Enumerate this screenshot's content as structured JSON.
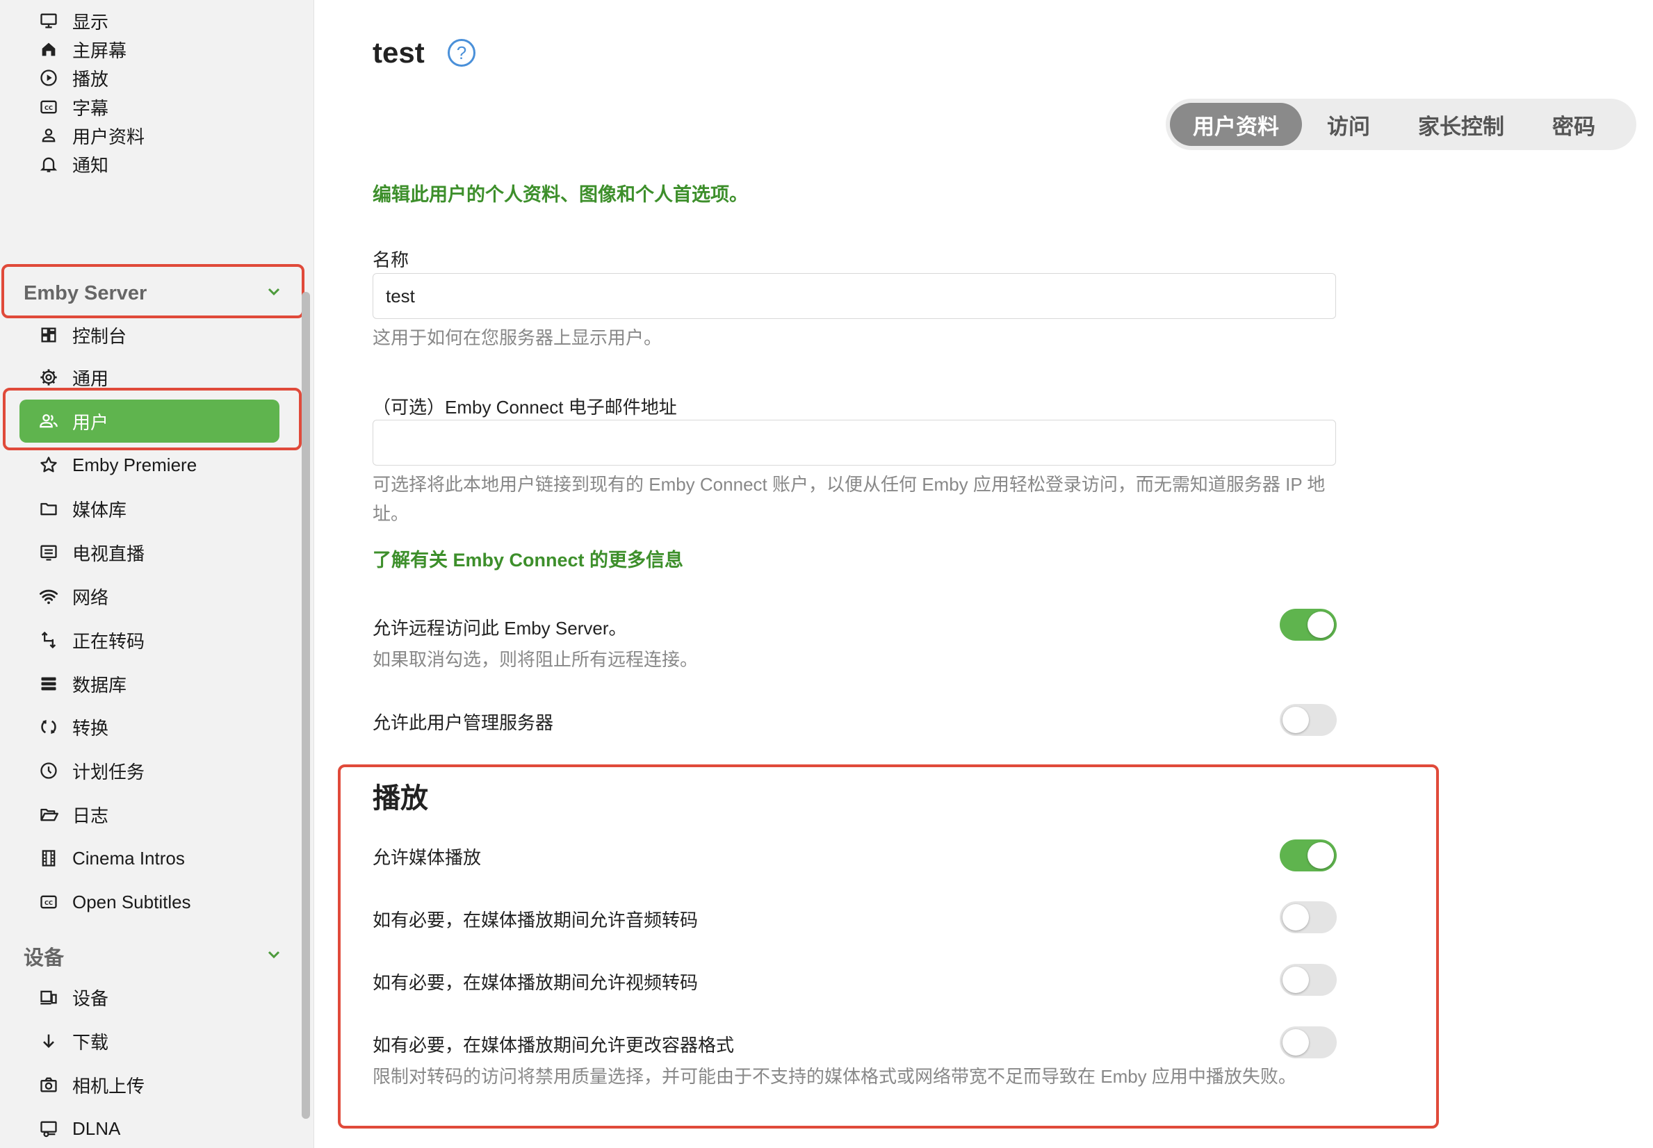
{
  "sidebar": {
    "items_top": [
      {
        "icon": "monitor-icon",
        "label": "显示"
      },
      {
        "icon": "home-icon",
        "label": "主屏幕"
      },
      {
        "icon": "play-circle-icon",
        "label": "播放"
      },
      {
        "icon": "cc-icon",
        "label": "字幕"
      },
      {
        "icon": "person-icon",
        "label": "用户资料"
      },
      {
        "icon": "bell-icon",
        "label": "通知"
      }
    ],
    "server_section": "Emby Server",
    "server_items": [
      {
        "icon": "dashboard-icon",
        "label": "控制台"
      },
      {
        "icon": "gear-icon",
        "label": "通用"
      },
      {
        "icon": "users-icon",
        "label": "用户"
      },
      {
        "icon": "star-icon",
        "label": "Emby Premiere"
      },
      {
        "icon": "folder-icon",
        "label": "媒体库"
      },
      {
        "icon": "tv-guide-icon",
        "label": "电视直播"
      },
      {
        "icon": "wifi-icon",
        "label": "网络"
      },
      {
        "icon": "transcode-icon",
        "label": "正在转码"
      },
      {
        "icon": "database-icon",
        "label": "数据库"
      },
      {
        "icon": "convert-icon",
        "label": "转换"
      },
      {
        "icon": "clock-icon",
        "label": "计划任务"
      },
      {
        "icon": "folder-open-icon",
        "label": "日志"
      },
      {
        "icon": "film-icon",
        "label": "Cinema Intros"
      },
      {
        "icon": "cc-icon",
        "label": "Open Subtitles"
      }
    ],
    "devices_section": "设备",
    "device_items": [
      {
        "icon": "devices-icon",
        "label": "设备"
      },
      {
        "icon": "download-icon",
        "label": "下载"
      },
      {
        "icon": "camera-icon",
        "label": "相机上传"
      },
      {
        "icon": "dlna-icon",
        "label": "DLNA"
      }
    ]
  },
  "main": {
    "title": "test",
    "tabs": [
      {
        "label": "用户资料",
        "active": true
      },
      {
        "label": "访问",
        "active": false
      },
      {
        "label": "家长控制",
        "active": false
      },
      {
        "label": "密码",
        "active": false
      }
    ],
    "intro": "编辑此用户的个人资料、图像和个人首选项。",
    "name_label": "名称",
    "name_value": "test",
    "name_help": "这用于如何在您服务器上显示用户。",
    "connect_label": "（可选）Emby Connect 电子邮件地址",
    "connect_value": "",
    "connect_help": "可选择将此本地用户链接到现有的 Emby Connect 账户，以便从任何 Emby 应用轻松登录访问，而无需知道服务器 IP 地址。",
    "connect_link": "了解有关 Emby Connect 的更多信息",
    "remote_label": "允许远程访问此 Emby Server。",
    "remote_help": "如果取消勾选，则将阻止所有远程连接。",
    "remote_on": true,
    "admin_label": "允许此用户管理服务器",
    "admin_on": false,
    "playback_title": "播放",
    "media_playback_label": "允许媒体播放",
    "media_playback_on": true,
    "audio_transcode_label": "如有必要，在媒体播放期间允许音频转码",
    "audio_transcode_on": false,
    "video_transcode_label": "如有必要，在媒体播放期间允许视频转码",
    "video_transcode_on": false,
    "remux_label": "如有必要，在媒体播放期间允许更改容器格式",
    "remux_on": false,
    "playback_help": "限制对转码的访问将禁用质量选择，并可能由于不支持的媒体格式或网络带宽不足而导致在 Emby 应用中播放失败。"
  },
  "colors": {
    "accent": "#5fb44e",
    "highlight": "#e04a3a",
    "link": "#3d8f2b"
  }
}
